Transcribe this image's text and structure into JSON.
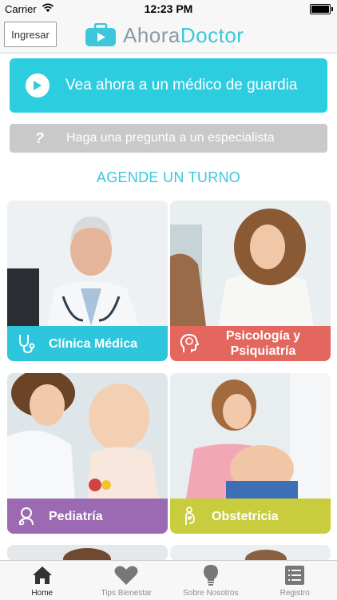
{
  "status_bar": {
    "carrier": "Carrier",
    "time": "12:23 PM"
  },
  "header": {
    "login_label": "Ingresar",
    "logo_part1": "Ahora",
    "logo_part2": "Doctor"
  },
  "main": {
    "urgent_button_label": "Vea ahora a un médico de guardia",
    "question_button_icon": "?",
    "question_button_label": "Haga una pregunta a un especialista",
    "section_title": "AGENDE UN TURNO"
  },
  "specialties": [
    {
      "label": "Clínica Médica",
      "icon": "stethoscope-icon",
      "color": "#2dc6dc"
    },
    {
      "label_line1": "Psicología y",
      "label_line2": "Psiquiatría",
      "icon": "brain-head-icon",
      "color": "#e3675f"
    },
    {
      "label": "Pediatría",
      "icon": "baby-icon",
      "color": "#9b6ab3"
    },
    {
      "label": "Obstetricia",
      "icon": "pregnant-icon",
      "color": "#c9cc3c"
    }
  ],
  "tab_bar": {
    "tabs": [
      {
        "label": "Home",
        "icon": "home-icon",
        "active": true
      },
      {
        "label": "Tips Bienestar",
        "icon": "heart-icon",
        "active": false
      },
      {
        "label": "Sobre Nosotros",
        "icon": "lightbulb-icon",
        "active": false
      },
      {
        "label": "Registro",
        "icon": "list-icon",
        "active": false
      }
    ]
  },
  "colors": {
    "accent": "#2dcde0",
    "gray_button": "#c9c9c9",
    "tab_icon": "#6b6b6b"
  }
}
